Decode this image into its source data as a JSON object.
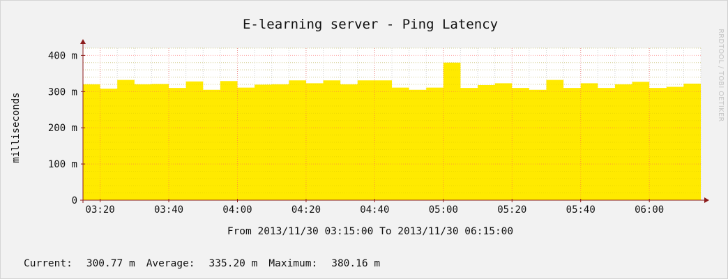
{
  "chart_data": {
    "type": "area",
    "title": "E-learning server - Ping Latency",
    "ylabel": "milliseconds",
    "xlabel": "From 2013/11/30 03:15:00 To 2013/11/30 06:15:00",
    "watermark": "RRDTOOL / TOBI OETIKER",
    "ylim": [
      0,
      420
    ],
    "yticks": [
      {
        "v": 0,
        "label": "0"
      },
      {
        "v": 100,
        "label": "100 m"
      },
      {
        "v": 200,
        "label": "200 m"
      },
      {
        "v": 300,
        "label": "300 m"
      },
      {
        "v": 400,
        "label": "400 m"
      }
    ],
    "xlim": [
      "03:15",
      "06:15"
    ],
    "xticks": [
      "03:20",
      "03:40",
      "04:00",
      "04:20",
      "04:40",
      "05:00",
      "05:20",
      "05:40",
      "06:00"
    ],
    "series": [
      {
        "color": "#ffea00",
        "x": [
          "03:15",
          "03:20",
          "03:25",
          "03:30",
          "03:35",
          "03:40",
          "03:45",
          "03:50",
          "03:55",
          "04:00",
          "04:05",
          "04:10",
          "04:15",
          "04:20",
          "04:25",
          "04:30",
          "04:35",
          "04:40",
          "04:45",
          "04:50",
          "04:55",
          "05:00",
          "05:05",
          "05:10",
          "05:15",
          "05:20",
          "05:25",
          "05:30",
          "05:35",
          "05:40",
          "05:45",
          "05:50",
          "05:55",
          "06:00",
          "06:05",
          "06:10"
        ],
        "values": [
          320,
          308,
          332,
          320,
          321,
          310,
          328,
          305,
          329,
          311,
          319,
          320,
          331,
          323,
          331,
          320,
          331,
          331,
          311,
          305,
          311,
          380,
          310,
          318,
          323,
          310,
          305,
          332,
          310,
          323,
          310,
          320,
          327,
          310,
          313,
          322
        ]
      }
    ],
    "colors": {
      "area": "#ffea00",
      "grid": "#ff5a5a",
      "axis": "#8b1a1a",
      "background": "#ffffff"
    }
  },
  "stats": {
    "current_label": "Current:",
    "current_value": "300.77 m",
    "average_label": "Average:",
    "average_value": "335.20 m",
    "maximum_label": "Maximum:",
    "maximum_value": "380.16 m"
  }
}
